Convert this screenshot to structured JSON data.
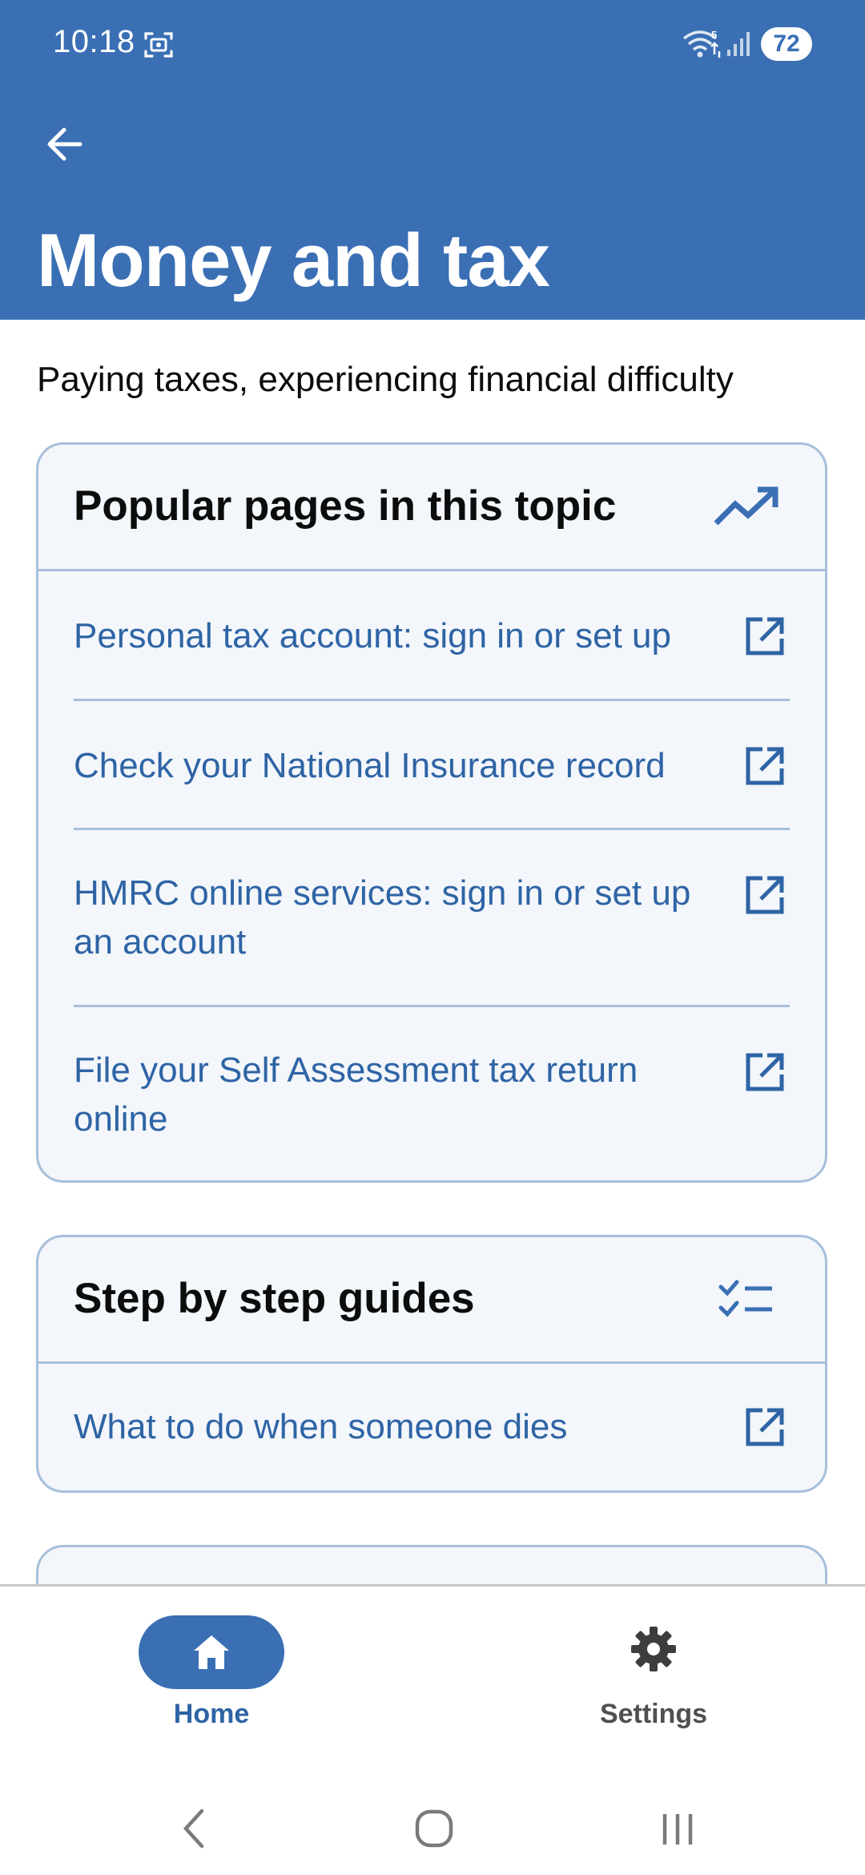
{
  "status_bar": {
    "time": "10:18",
    "battery": "72"
  },
  "header": {
    "title": "Money and tax",
    "back_icon": "arrow-left-icon"
  },
  "subtitle": "Paying taxes, experiencing financial difficulty",
  "popular_card": {
    "title": "Popular pages in this topic",
    "icon": "trending-up-icon",
    "links": [
      {
        "label": "Personal tax account: sign in or set up",
        "icon": "external-link-icon"
      },
      {
        "label": "Check your National Insurance record",
        "icon": "external-link-icon"
      },
      {
        "label": "HMRC online services: sign in or set up an account",
        "icon": "external-link-icon"
      },
      {
        "label": "File your Self Assessment tax return online",
        "icon": "external-link-icon"
      }
    ]
  },
  "steps_card": {
    "title": "Step by step guides",
    "icon": "checklist-icon",
    "links": [
      {
        "label": "What to do when someone dies",
        "icon": "external-link-icon"
      }
    ]
  },
  "bottom_nav": {
    "items": [
      {
        "label": "Home",
        "icon": "home-icon",
        "selected": true
      },
      {
        "label": "Settings",
        "icon": "gear-icon",
        "selected": false
      }
    ]
  },
  "colors": {
    "brand_blue": "#3a6fb4",
    "link_blue": "#2e64a5",
    "card_border": "#a7bfda",
    "card_background": "#f3f6fa"
  }
}
